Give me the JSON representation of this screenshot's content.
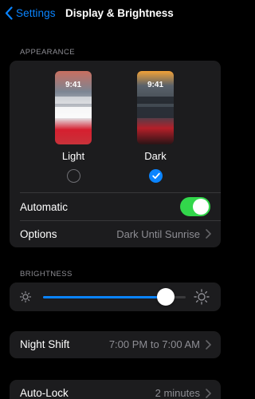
{
  "nav": {
    "back_label": "Settings",
    "title": "Display & Brightness"
  },
  "appearance": {
    "header": "APPEARANCE",
    "options": [
      {
        "label": "Light",
        "preview_time": "9:41",
        "selected": false
      },
      {
        "label": "Dark",
        "preview_time": "9:41",
        "selected": true
      }
    ],
    "automatic_label": "Automatic",
    "automatic_on": true,
    "options_row_label": "Options",
    "options_row_value": "Dark Until Sunrise"
  },
  "brightness": {
    "header": "BRIGHTNESS",
    "level": 0.86
  },
  "night_shift": {
    "label": "Night Shift",
    "value": "7:00 PM to 7:00 AM"
  },
  "auto_lock": {
    "label": "Auto-Lock",
    "value": "2 minutes"
  },
  "colors": {
    "accent": "#0a84ff",
    "toggle_on": "#32d74b",
    "card": "#1c1c1e",
    "secondary_text": "#8d8d93"
  },
  "icons": [
    "chevron-left-icon",
    "checkmark-icon",
    "chevron-right-icon",
    "sun-small-icon",
    "sun-large-icon"
  ]
}
